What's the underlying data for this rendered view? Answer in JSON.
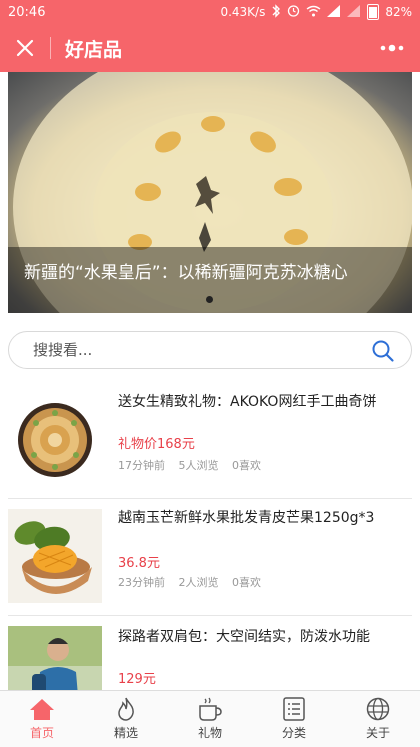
{
  "status_bar": {
    "time": "20:46",
    "network_speed": "0.43K/s",
    "battery": "82%"
  },
  "header": {
    "title": "好店品"
  },
  "banner": {
    "title": "新疆的“水果皇后”：以稀新疆阿克苏冰糖心"
  },
  "search": {
    "placeholder": "搜搜看..."
  },
  "products": [
    {
      "title": "送女生精致礼物：AKOKO网红手工曲奇饼",
      "price": "礼物价168元",
      "time": "17分钟前",
      "views": "5人浏览",
      "likes": "0喜欢"
    },
    {
      "title": "越南玉芒新鲜水果批发青皮芒果1250g*3",
      "price": "36.8元",
      "time": "23分钟前",
      "views": "2人浏览",
      "likes": "0喜欢"
    },
    {
      "title": "探路者双肩包：大空间结实，防泼水功能",
      "price": "129元"
    }
  ],
  "tabbar": {
    "items": [
      {
        "label": "首页",
        "icon": "home-icon",
        "active": true
      },
      {
        "label": "精选",
        "icon": "flame-icon",
        "active": false
      },
      {
        "label": "礼物",
        "icon": "cup-icon",
        "active": false
      },
      {
        "label": "分类",
        "icon": "list-icon",
        "active": false
      },
      {
        "label": "关于",
        "icon": "globe-icon",
        "active": false
      }
    ]
  },
  "colors": {
    "accent": "#f6656a",
    "price": "#e8414a"
  }
}
